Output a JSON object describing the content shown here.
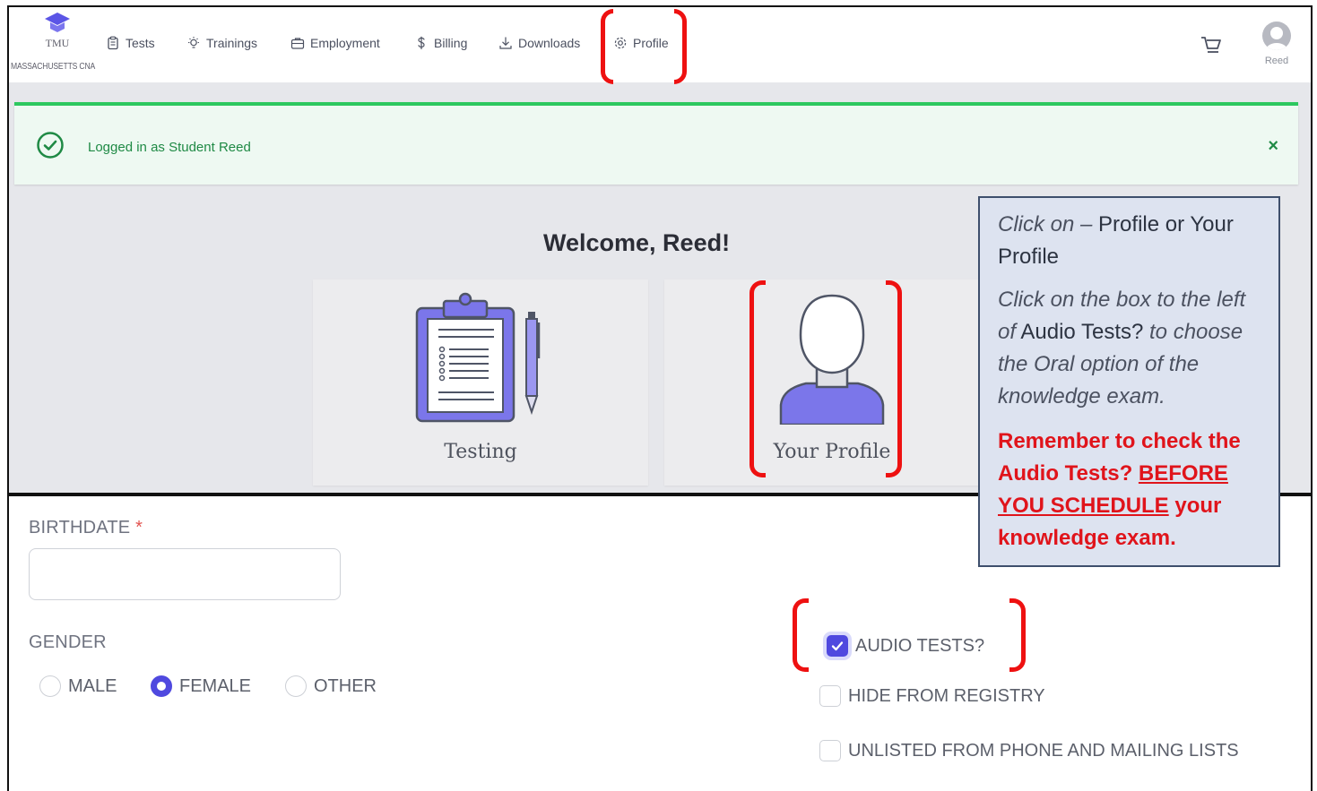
{
  "app": {
    "logo_text": "TMU",
    "logo_state": "MASSACHUSETTS CNA"
  },
  "nav": {
    "items": [
      {
        "label": "Tests",
        "icon": "clipboard-icon"
      },
      {
        "label": "Trainings",
        "icon": "lightbulb-icon"
      },
      {
        "label": "Employment",
        "icon": "briefcase-icon"
      },
      {
        "label": "Billing",
        "icon": "dollar-icon"
      },
      {
        "label": "Downloads",
        "icon": "download-icon"
      },
      {
        "label": "Profile",
        "icon": "gear-icon"
      }
    ],
    "cart_icon": "cart-icon",
    "user_label": "Reed"
  },
  "alert": {
    "message": "Logged in as Student Reed",
    "close": "×",
    "color": "#2dc85f"
  },
  "welcome": {
    "title": "Welcome, Reed!"
  },
  "cards": [
    {
      "label": "Testing",
      "icon": "clipboard-pen-icon"
    },
    {
      "label": "Your Profile",
      "icon": "person-icon"
    }
  ],
  "form": {
    "birthdate_label": "BIRTHDATE",
    "required_mark": "*",
    "birthdate_value": "",
    "gender_label": "GENDER",
    "gender_options": [
      "MALE",
      "FEMALE",
      "OTHER"
    ],
    "gender_selected": "FEMALE",
    "checkboxes": [
      {
        "label": "AUDIO TESTS?",
        "checked": true
      },
      {
        "label": "HIDE FROM REGISTRY",
        "checked": false
      },
      {
        "label": "UNLISTED FROM PHONE AND MAILING LISTS",
        "checked": false
      }
    ]
  },
  "callout": {
    "p1_italic": "Click on –",
    "p1_normal": "Profile or Your Profile",
    "p2_italic_a": "Click on the box to the left of",
    "p2_normal": "Audio Tests?",
    "p2_italic_b": "to choose the Oral option of the knowledge exam.",
    "warn_a": "Remember to check the Audio Tests?",
    "warn_u": "BEFORE YOU SCHEDULE",
    "warn_b": "your knowledge exam."
  },
  "colors": {
    "accent": "#4f49df",
    "highlight": "#ee1111",
    "callout_bg": "#dde3f0"
  }
}
